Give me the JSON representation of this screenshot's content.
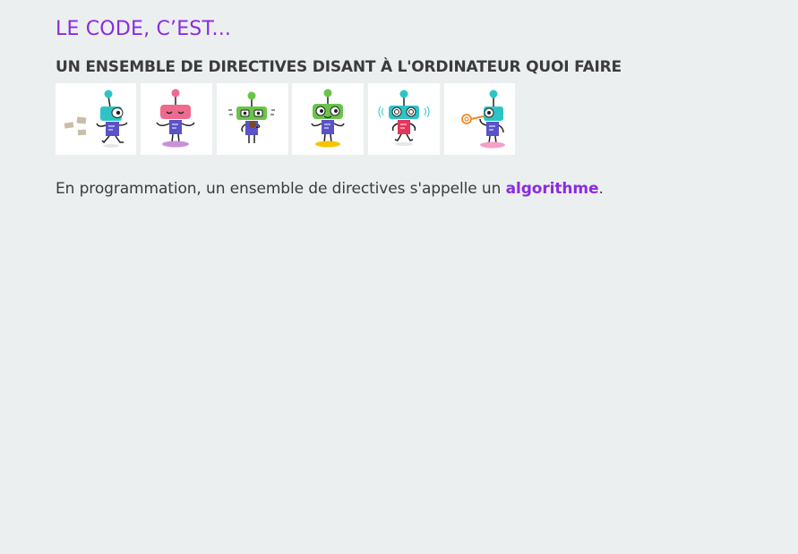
{
  "page": {
    "title": "LE CODE, C’EST...",
    "subtitle": "UN ENSEMBLE DE DIRECTIVES DISANT À L'ORDINATEUR QUOI FAIRE",
    "paragraph": {
      "before": "En programmation, un ensemble de directives s'appelle un ",
      "keyword": "algorithme",
      "after": "."
    }
  },
  "robots": [
    {
      "icon": "robot-walking-icon",
      "head_color": "#2ec4c6",
      "body_color": "#5a52c8",
      "antenna_color": "#2ec4c6"
    },
    {
      "icon": "robot-relaxed-icon",
      "head_color": "#ee6a8f",
      "body_color": "#5a52c8",
      "antenna_color": "#ee6a8f"
    },
    {
      "icon": "robot-eating-icon",
      "head_color": "#6ac44a",
      "body_color": "#5a52c8",
      "antenna_color": "#6ac44a"
    },
    {
      "icon": "robot-happy-icon",
      "head_color": "#6ac44a",
      "body_color": "#5a52c8",
      "antenna_color": "#6ac44a"
    },
    {
      "icon": "robot-dizzy-icon",
      "head_color": "#2ec4c6",
      "body_color": "#e8345a",
      "antenna_color": "#2ec4c6"
    },
    {
      "icon": "robot-trumpet-icon",
      "head_color": "#2ec4c6",
      "body_color": "#5a52c8",
      "antenna_color": "#2ec4c6"
    }
  ],
  "colors": {
    "accent": "#8a2be2",
    "background": "#ecefef",
    "text": "#3b3b3b"
  }
}
